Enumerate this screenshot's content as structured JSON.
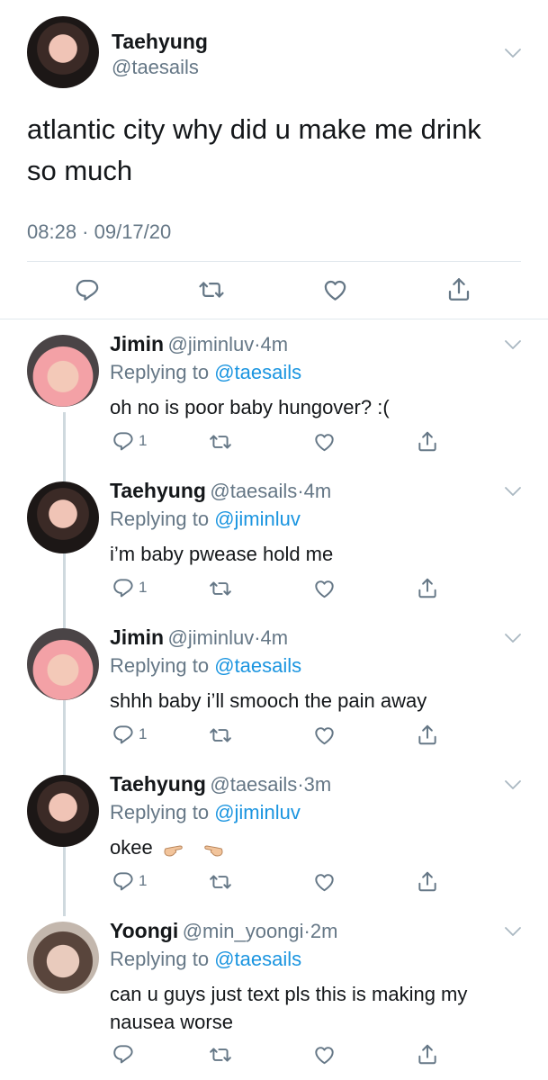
{
  "main_tweet": {
    "author_name": "Taehyung",
    "author_handle": "@taesails",
    "text": "atlantic city why did u make me drink so much",
    "timestamp": "08:28 · 09/17/20"
  },
  "replies": [
    {
      "name": "Jimin",
      "handle": "@jiminluv",
      "dot": "·",
      "time": "4m",
      "replying_prefix": "Replying to",
      "replying_to": "@taesails",
      "text": "oh no is poor baby hungover? :(",
      "reply_count": "1"
    },
    {
      "name": "Taehyung",
      "handle": "@taesails",
      "dot": "·",
      "time": "4m",
      "replying_prefix": "Replying to",
      "replying_to": "@jiminluv",
      "text": "i’m baby pwease hold me",
      "reply_count": "1"
    },
    {
      "name": "Jimin",
      "handle": "@jiminluv",
      "dot": "·",
      "time": "4m",
      "replying_prefix": "Replying to",
      "replying_to": "@taesails",
      "text": "shhh baby i’ll smooch the pain away",
      "reply_count": "1"
    },
    {
      "name": "Taehyung",
      "handle": "@taesails",
      "dot": "·",
      "time": "3m",
      "replying_prefix": "Replying to",
      "replying_to": "@jiminluv",
      "text": "okee",
      "reply_count": "1"
    },
    {
      "name": "Yoongi",
      "handle": "@min_yoongi",
      "dot": "·",
      "time": "2m",
      "replying_prefix": "Replying to",
      "replying_to": "@taesails",
      "text": "can u guys just text pls this is making my nausea worse",
      "reply_count": ""
    }
  ],
  "icons": {
    "reply": "reply-icon",
    "retweet": "retweet-icon",
    "like": "like-icon",
    "share": "share-icon",
    "more": "chevron-down-icon",
    "emoji": "pointing-fingers-emoji"
  },
  "colors": {
    "link": "#1b95e0",
    "secondary": "#657786",
    "icon": "#657786",
    "divider": "#e1e8ed"
  }
}
